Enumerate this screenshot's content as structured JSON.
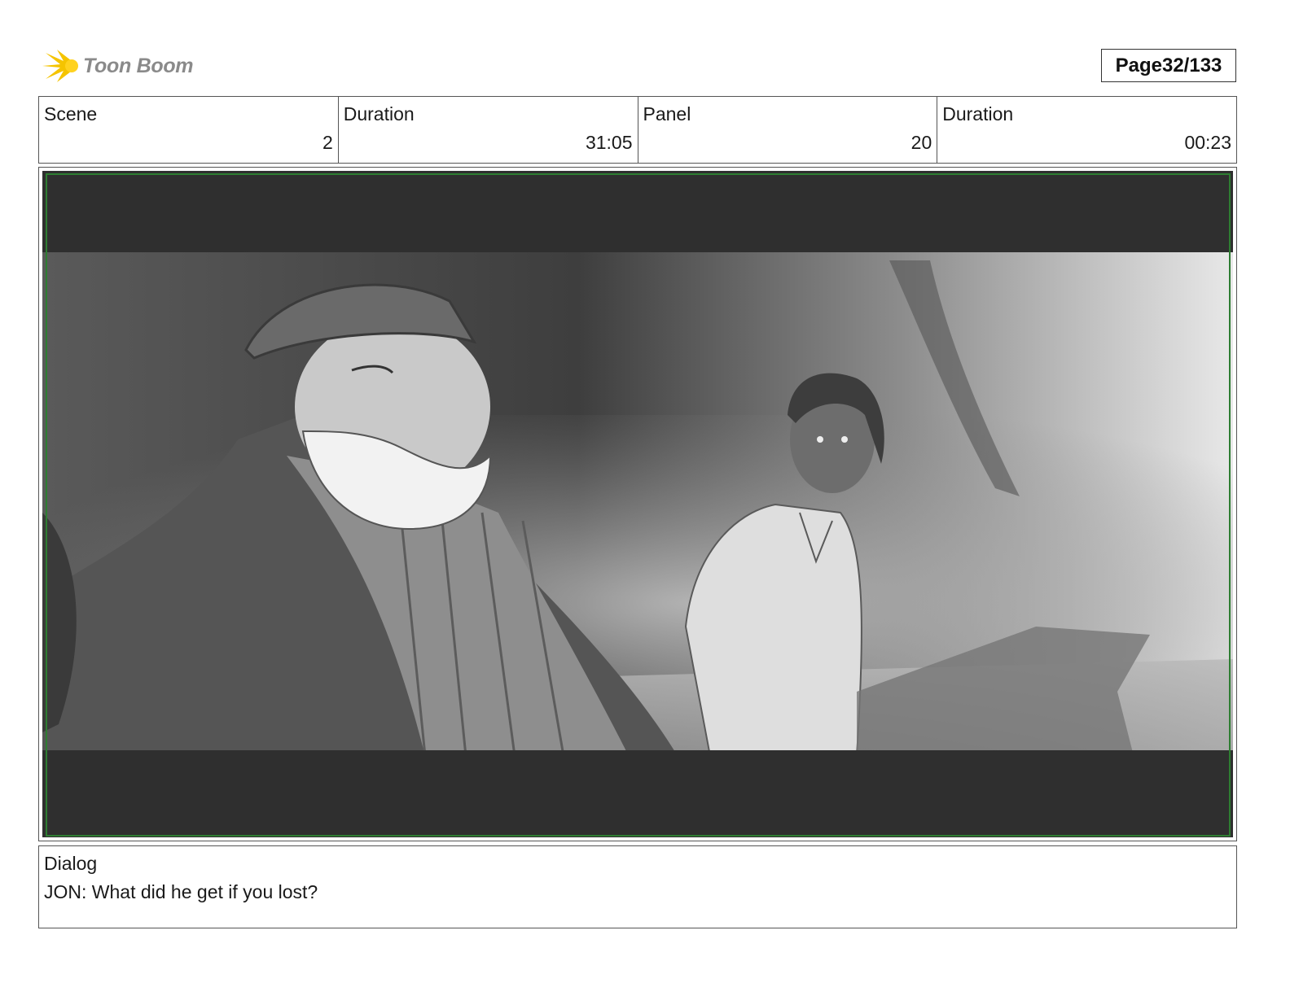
{
  "header": {
    "logo_text": "Toon Boom",
    "page_label": "Page",
    "page_value": "32/133"
  },
  "info": {
    "scene": {
      "label": "Scene",
      "value": "2"
    },
    "scene_duration": {
      "label": "Duration",
      "value": "31:05"
    },
    "panel": {
      "label": "Panel",
      "value": "20"
    },
    "panel_duration": {
      "label": "Duration",
      "value": "00:23"
    }
  },
  "dialog": {
    "label": "Dialog",
    "text": "JON: What did he get if you lost?"
  },
  "colors": {
    "logo_yellow": "#f5c400",
    "logo_text": "#8a8a8a",
    "letterbox": "#2f2f2f",
    "safe_frame": "#2e7d32"
  }
}
